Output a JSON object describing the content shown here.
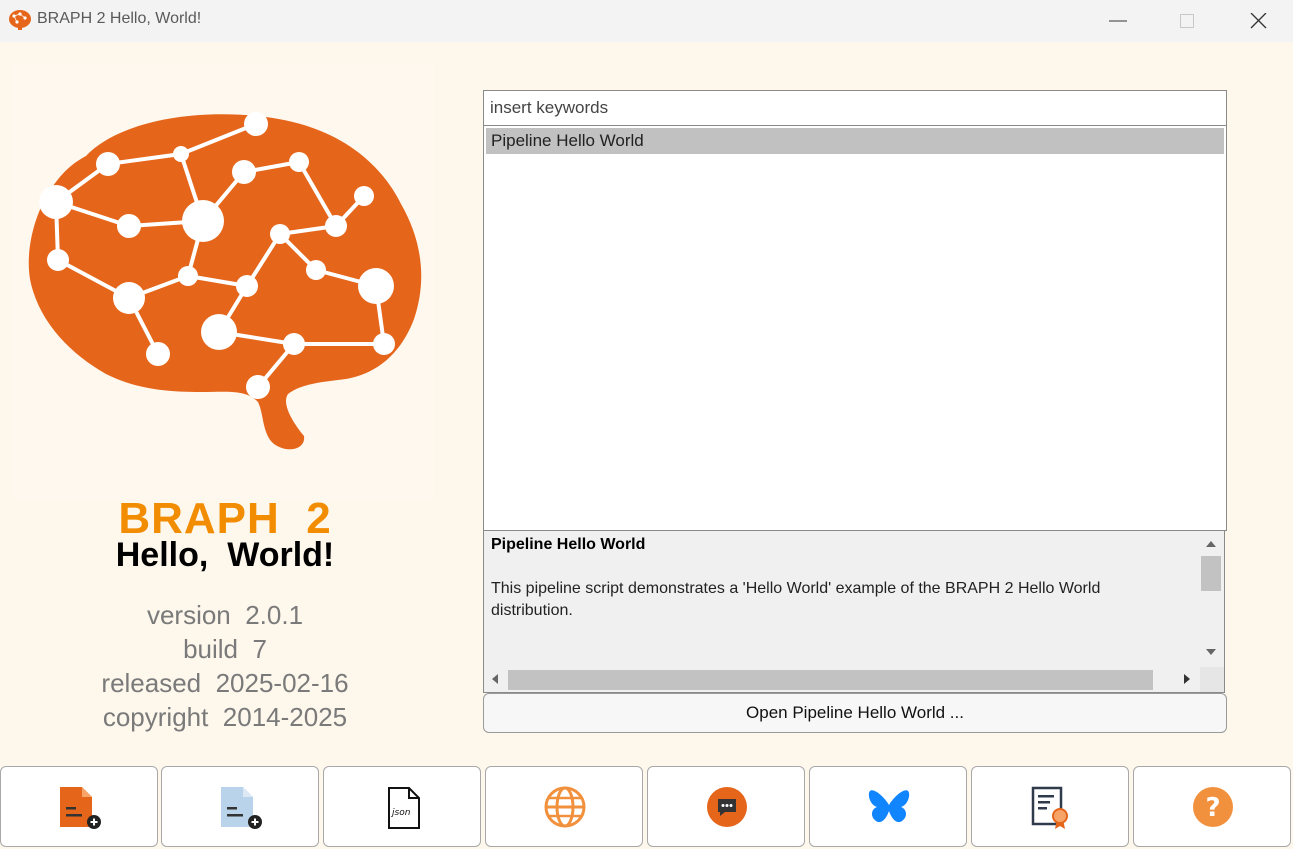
{
  "window": {
    "title": "BRAPH 2 Hello, World!",
    "controls": [
      "minimize",
      "maximize",
      "close"
    ]
  },
  "brand": {
    "name": "BRAPH  2",
    "subtitle": "Hello,  World!",
    "version": "version  2.0.1",
    "build": "build  7",
    "released": "released  2025-02-16",
    "copyright": "copyright  2014-2025",
    "colors": {
      "orange": "#f28c00",
      "logo": "#e5651a"
    }
  },
  "search": {
    "placeholder": "insert keywords",
    "value": ""
  },
  "pipelines": {
    "items": [
      {
        "label": "Pipeline Hello World",
        "selected": true
      }
    ]
  },
  "description": {
    "title": "Pipeline Hello World",
    "body": "This pipeline script demonstrates a 'Hello World' example of the BRAPH 2 Hello World distribution."
  },
  "open_button": {
    "label": "Open Pipeline Hello World ..."
  },
  "toolbar": {
    "buttons": [
      {
        "icon": "new-file-orange-icon"
      },
      {
        "icon": "new-file-blue-icon"
      },
      {
        "icon": "json-file-icon"
      },
      {
        "icon": "globe-icon"
      },
      {
        "icon": "chat-bubble-icon"
      },
      {
        "icon": "butterfly-icon"
      },
      {
        "icon": "certificate-icon"
      },
      {
        "icon": "help-icon"
      }
    ]
  }
}
